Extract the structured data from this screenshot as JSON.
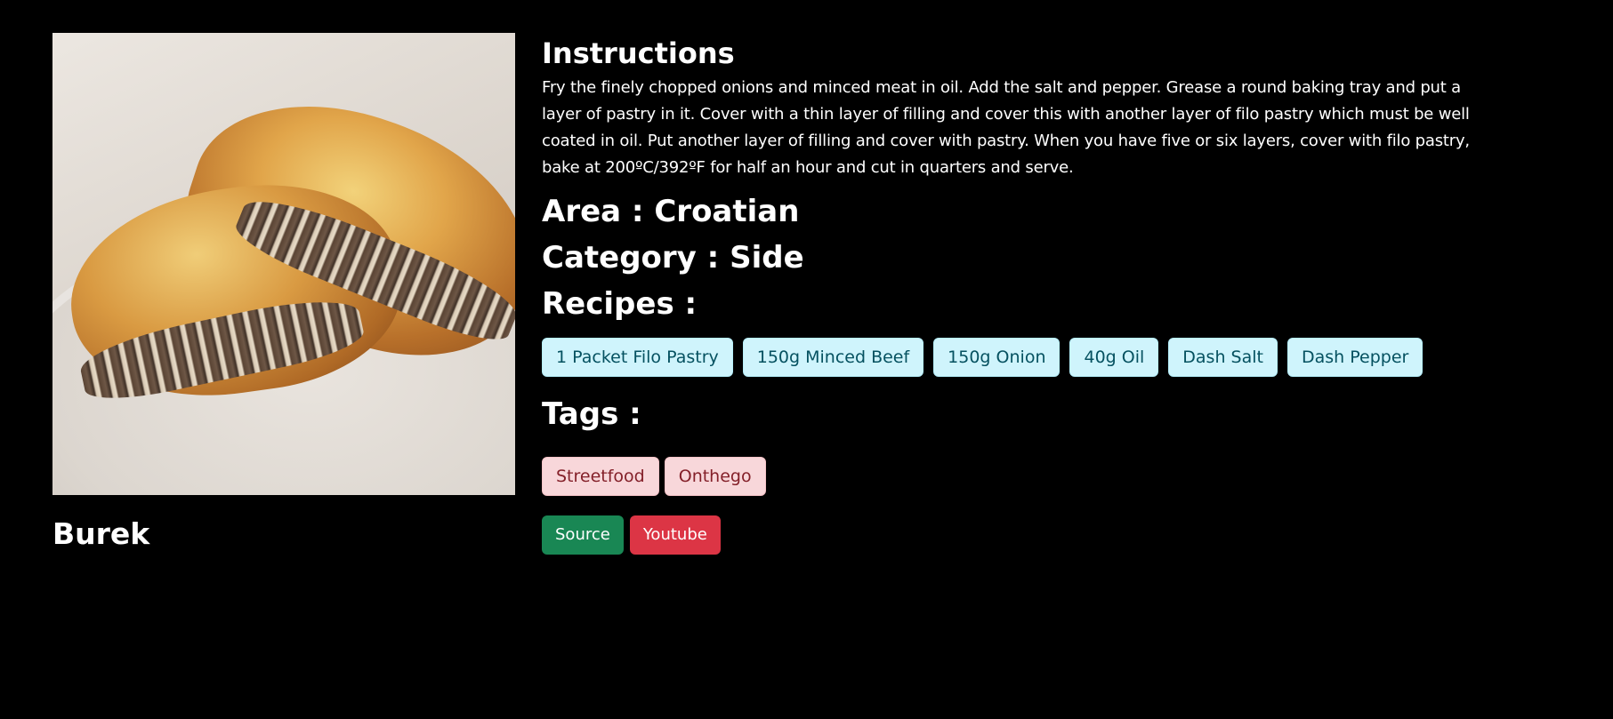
{
  "meal": {
    "name": "Burek",
    "image_alt": "Burek"
  },
  "instructions": {
    "title": "Instructions",
    "text": "Fry the finely chopped onions and minced meat in oil. Add the salt and pepper. Grease a round baking tray and put a layer of pastry in it. Cover with a thin layer of filling and cover this with another layer of filo pastry which must be well coated in oil. Put another layer of filling and cover with pastry. When you have five or six layers, cover with filo pastry, bake at 200ºC/392ºF for half an hour and cut in quarters and serve."
  },
  "area": {
    "text": "Area : Croatian"
  },
  "category": {
    "text": "Category : Side"
  },
  "recipes": {
    "title": "Recipes :",
    "items": [
      "1 Packet Filo Pastry",
      "150g Minced Beef",
      "150g Onion",
      "40g Oil",
      "Dash Salt",
      "Dash Pepper"
    ]
  },
  "tags": {
    "title": "Tags :",
    "items": [
      "Streetfood",
      "Onthego"
    ]
  },
  "actions": {
    "source_label": "Source",
    "youtube_label": "Youtube"
  },
  "colors": {
    "background": "#000000",
    "ingredient_chip_bg": "#cff4fc",
    "ingredient_chip_text": "#055160",
    "tag_chip_bg": "#f8d7da",
    "tag_chip_text": "#842029",
    "source_button": "#198754",
    "youtube_button": "#dc3545"
  }
}
